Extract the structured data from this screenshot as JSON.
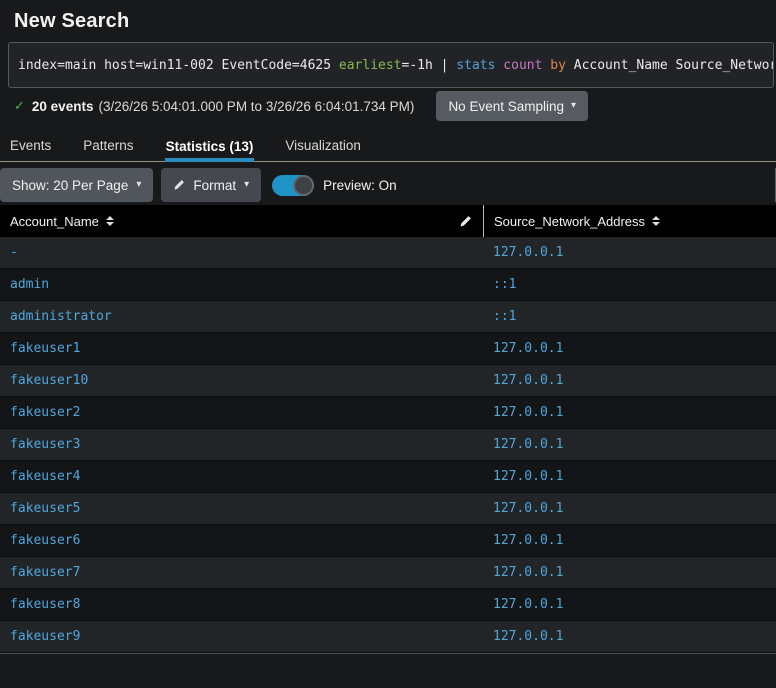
{
  "title": "New Search",
  "icons": {
    "check": "✓",
    "caret_down": "▾"
  },
  "search": {
    "syntax_colors": {
      "plain": "#eaeaea",
      "modifier": "#89b84c",
      "command": "#55a0d8",
      "function": "#c977c3",
      "keyword": "#dd8549"
    },
    "tokens": [
      {
        "text": "index=main host=win11-002 EventCode=4625 ",
        "type": "plain"
      },
      {
        "text": "earliest",
        "type": "modifier"
      },
      {
        "text": "=-1h ",
        "type": "plain"
      },
      {
        "text": "| ",
        "type": "plain"
      },
      {
        "text": "stats",
        "type": "command"
      },
      {
        "text": " ",
        "type": "plain"
      },
      {
        "text": "count",
        "type": "function"
      },
      {
        "text": " ",
        "type": "plain"
      },
      {
        "text": "by",
        "type": "keyword"
      },
      {
        "text": " Account_Name Source_Network_Address",
        "type": "plain"
      }
    ]
  },
  "events_bar": {
    "count": "20 events",
    "time_range": "(3/26/26 5:04:01.000 PM to 3/26/26 6:04:01.734 PM)",
    "sampling_button_label": "No Event Sampling"
  },
  "tabs": [
    {
      "label": "Events",
      "active": false
    },
    {
      "label": "Patterns",
      "active": false
    },
    {
      "label": "Statistics (13)",
      "active": true
    },
    {
      "label": "Visualization",
      "active": false
    }
  ],
  "controls": {
    "show_button_label": "Show: 20 Per Page",
    "format_button_label": "Format",
    "preview_label": "Preview: On",
    "preview_state": "on"
  },
  "table": {
    "columns": [
      "Account_Name",
      "Source_Network_Address"
    ],
    "link_color": "#4fa7db",
    "rows": [
      [
        "-",
        "127.0.0.1"
      ],
      [
        "admin",
        "::1"
      ],
      [
        "administrator",
        "::1"
      ],
      [
        "fakeuser1",
        "127.0.0.1"
      ],
      [
        "fakeuser10",
        "127.0.0.1"
      ],
      [
        "fakeuser2",
        "127.0.0.1"
      ],
      [
        "fakeuser3",
        "127.0.0.1"
      ],
      [
        "fakeuser4",
        "127.0.0.1"
      ],
      [
        "fakeuser5",
        "127.0.0.1"
      ],
      [
        "fakeuser6",
        "127.0.0.1"
      ],
      [
        "fakeuser7",
        "127.0.0.1"
      ],
      [
        "fakeuser8",
        "127.0.0.1"
      ],
      [
        "fakeuser9",
        "127.0.0.1"
      ]
    ]
  },
  "colors": {
    "accent_blue": "#1e93c6",
    "tab_underline": "#2b8cbf",
    "success_green": "#4fae54",
    "header_bg": "#000000",
    "row_odd": "#222528",
    "row_even": "#131517"
  }
}
